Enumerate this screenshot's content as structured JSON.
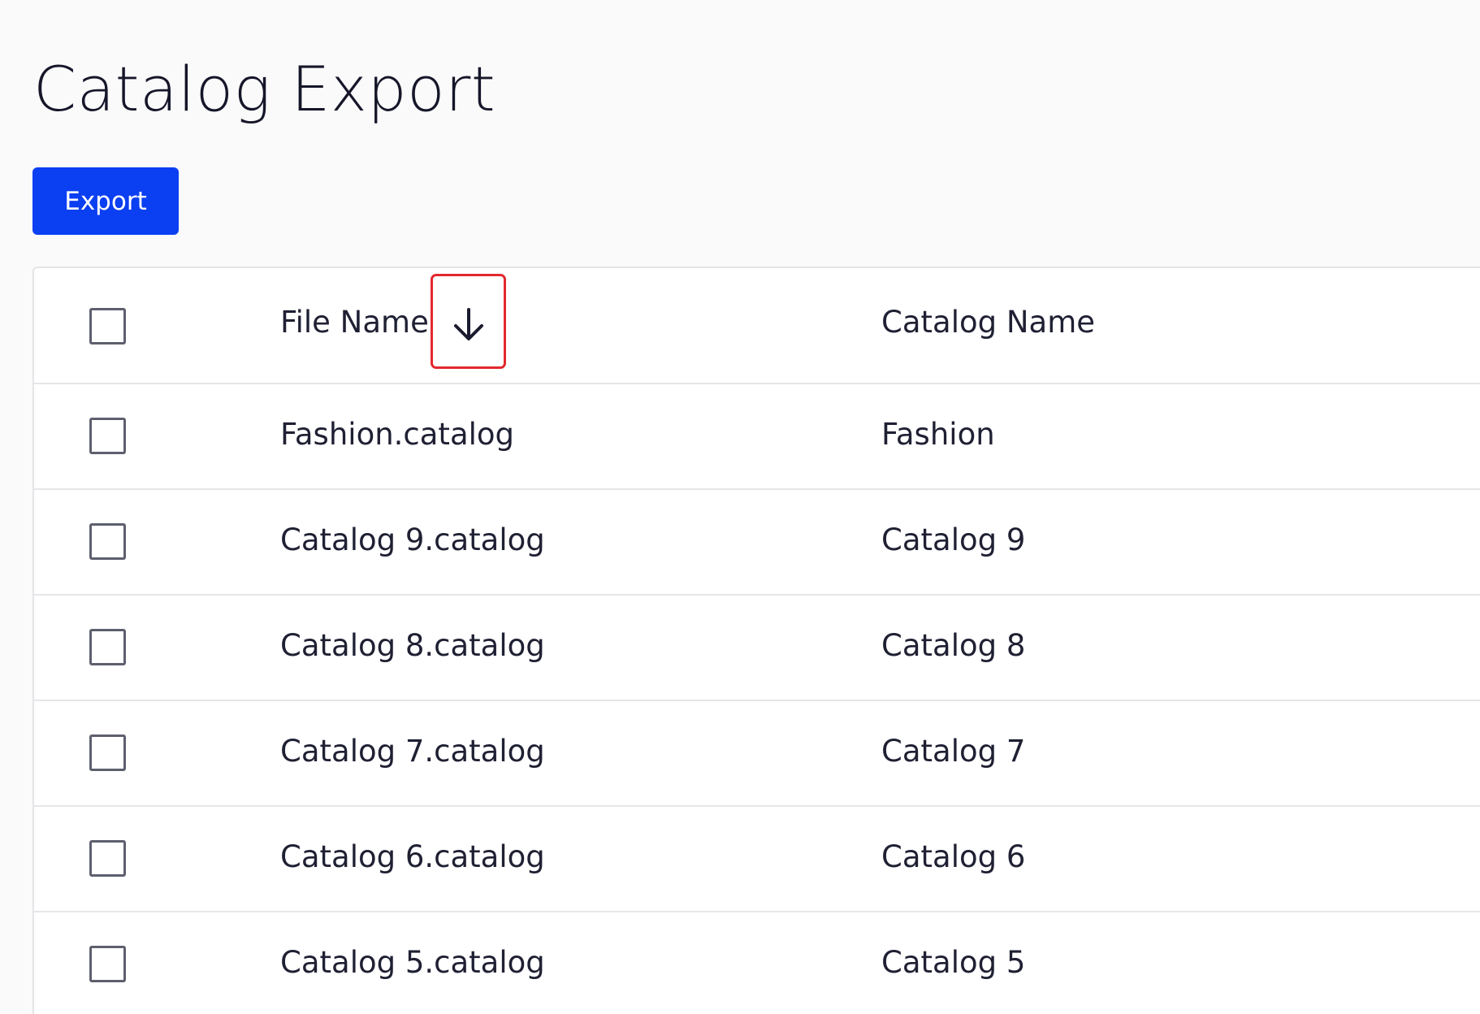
{
  "page": {
    "title": "Catalog Export"
  },
  "toolbar": {
    "export_label": "Export"
  },
  "table": {
    "columns": {
      "file_name": "File Name",
      "catalog_name": "Catalog Name"
    },
    "sort": {
      "column": "File Name",
      "direction": "descending",
      "icon": "arrow-down-icon"
    },
    "rows": [
      {
        "file_name": "Fashion.catalog",
        "catalog_name": "Fashion"
      },
      {
        "file_name": "Catalog 9.catalog",
        "catalog_name": "Catalog 9"
      },
      {
        "file_name": "Catalog 8.catalog",
        "catalog_name": "Catalog 8"
      },
      {
        "file_name": "Catalog 7.catalog",
        "catalog_name": "Catalog 7"
      },
      {
        "file_name": "Catalog 6.catalog",
        "catalog_name": "Catalog 6"
      },
      {
        "file_name": "Catalog 5.catalog",
        "catalog_name": "Catalog 5"
      }
    ]
  },
  "colors": {
    "accent": "#0b3ff2",
    "highlight": "#e3282e"
  }
}
